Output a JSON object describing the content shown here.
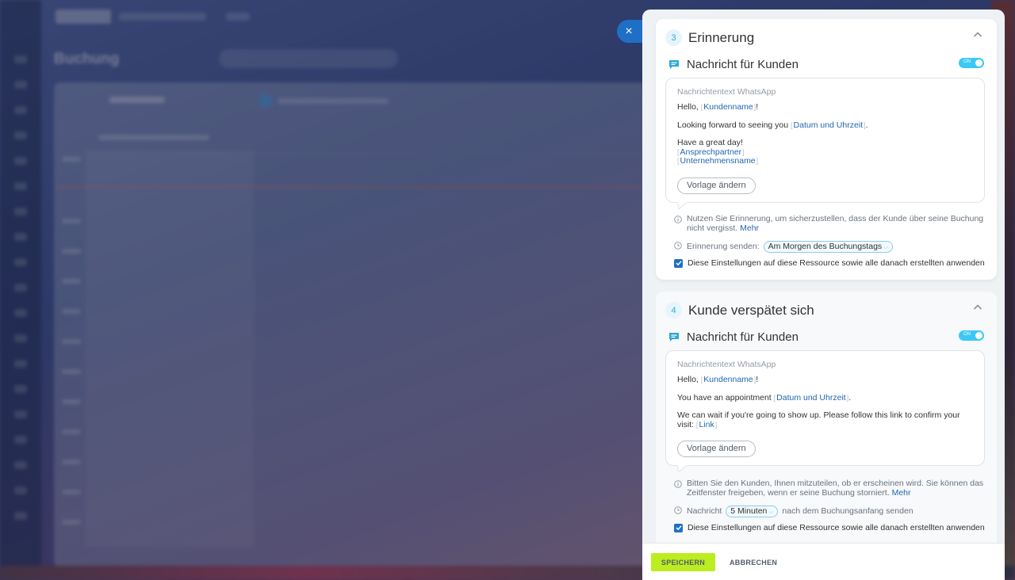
{
  "background": {
    "page_title": "Buchung"
  },
  "close_button": {
    "icon": "close-icon",
    "glyph": "×"
  },
  "sections": [
    {
      "number": "3",
      "title": "Erinnerung",
      "message_title": "Nachricht für Kunden",
      "toggle_label": "ON",
      "box_label": "Nachrichtentext WhatsApp",
      "greeting_prefix": "Hello,",
      "greeting_tag": "Kundenname",
      "greeting_suffix": "!",
      "line2_prefix": "Looking forward to seeing you",
      "line2_tag": "Datum und Uhrzeit",
      "line2_suffix": ".",
      "line3": "Have a great day!",
      "tag_contact": "Ansprechpartner",
      "tag_company": "Unternehmensname",
      "template_button": "Vorlage ändern",
      "info_text": "Nutzen Sie Erinnerung, um sicherzustellen, dass der Kunde über seine Buchung nicht vergisst.",
      "info_more": "Mehr",
      "send_label": "Erinnerung senden:",
      "send_value": "Am Morgen des Buchungstags",
      "apply_label": "Diese Einstellungen auf diese Ressource sowie alle danach erstellten anwenden"
    },
    {
      "number": "4",
      "title": "Kunde verspätet sich",
      "message_title": "Nachricht für Kunden",
      "toggle_label": "ON",
      "box_label": "Nachrichtentext WhatsApp",
      "greeting_prefix": "Hello,",
      "greeting_tag": "Kundenname",
      "greeting_suffix": "!",
      "line2_prefix": "You have an appointment",
      "line2_tag": "Datum und Uhrzeit",
      "line2_suffix": ".",
      "line3_prefix": "We can wait if you're going to show up. Please follow this link to confirm your visit:",
      "line3_tag": "Link",
      "template_button": "Vorlage ändern",
      "info_text": "Bitten Sie den Kunden, Ihnen mitzuteilen, ob er erscheinen wird. Sie können das Zeitfenster freigeben, wenn er seine Buchung storniert.",
      "info_more": "Mehr",
      "send_prefix": "Nachricht",
      "send_value": "5 Minuten",
      "send_suffix": "nach dem Buchungsanfang senden",
      "apply_label": "Diese Einstellungen auf diese Ressource sowie alle danach erstellten anwenden"
    }
  ],
  "footer": {
    "save_label": "SPEICHERN",
    "cancel_label": "ABBRECHEN"
  },
  "colors": {
    "accent": "#3bc8f5",
    "link": "#2067b0",
    "save": "#bbed21",
    "close": "#1f6fc6"
  }
}
